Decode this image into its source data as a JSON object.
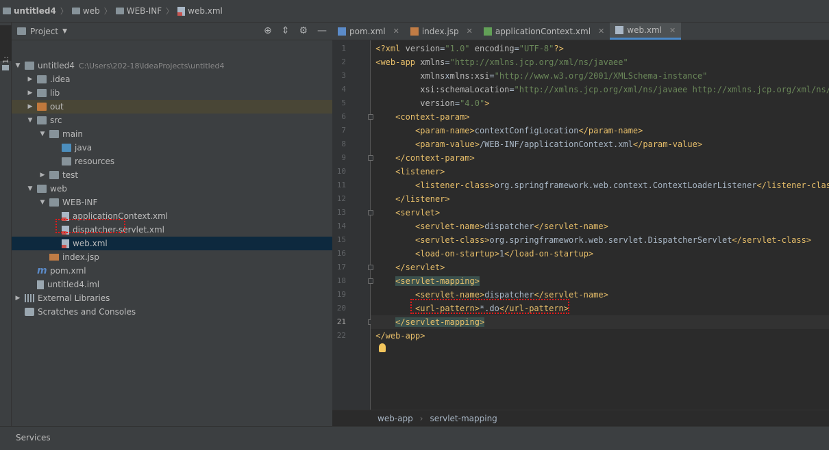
{
  "navbar": {
    "crumbs": [
      "untitled4",
      "web",
      "WEB-INF",
      "web.xml"
    ]
  },
  "left_strip": {
    "project_tab": "1: Project"
  },
  "project_panel": {
    "title": "Project",
    "tree": [
      {
        "label": "untitled4",
        "path": "C:\\Users\\202-18\\IdeaProjects\\untitled4",
        "depth": 0,
        "arrow": "▼",
        "icon": "folder"
      },
      {
        "label": ".idea",
        "depth": 1,
        "arrow": "▶",
        "icon": "folder"
      },
      {
        "label": "lib",
        "depth": 1,
        "arrow": "▶",
        "icon": "folder"
      },
      {
        "label": "out",
        "depth": 1,
        "arrow": "▶",
        "icon": "folder-orange"
      },
      {
        "label": "src",
        "depth": 1,
        "arrow": "▼",
        "icon": "folder"
      },
      {
        "label": "main",
        "depth": 2,
        "arrow": "▼",
        "icon": "folder"
      },
      {
        "label": "java",
        "depth": 3,
        "arrow": "",
        "icon": "folder-blue"
      },
      {
        "label": "resources",
        "depth": 3,
        "arrow": "",
        "icon": "folder"
      },
      {
        "label": "test",
        "depth": 2,
        "arrow": "▶",
        "icon": "folder"
      },
      {
        "label": "web",
        "depth": 1,
        "arrow": "▼",
        "icon": "folder"
      },
      {
        "label": "WEB-INF",
        "depth": 2,
        "arrow": "▼",
        "icon": "folder"
      },
      {
        "label": "applicationContext.xml",
        "depth": 3,
        "arrow": "",
        "icon": "xml"
      },
      {
        "label": "dispatcher-servlet.xml",
        "depth": 3,
        "arrow": "",
        "icon": "xml"
      },
      {
        "label": "web.xml",
        "depth": 3,
        "arrow": "",
        "icon": "xml"
      },
      {
        "label": "index.jsp",
        "depth": 2,
        "arrow": "",
        "icon": "jsp"
      },
      {
        "label": "pom.xml",
        "depth": 1,
        "arrow": "",
        "icon": "maven"
      },
      {
        "label": "untitled4.iml",
        "depth": 1,
        "arrow": "",
        "icon": "iml"
      },
      {
        "label": "External Libraries",
        "depth": 0,
        "arrow": "▶",
        "icon": "libraries"
      },
      {
        "label": "Scratches and Consoles",
        "depth": 0,
        "arrow": "",
        "icon": "scratch"
      }
    ],
    "selected_item": "web.xml"
  },
  "editor": {
    "tabs": [
      {
        "label": "pom.xml",
        "icon": "maven-icon",
        "active": false
      },
      {
        "label": "index.jsp",
        "icon": "jsp-icon",
        "active": false
      },
      {
        "label": "applicationContext.xml",
        "icon": "spring-xml-icon",
        "active": false
      },
      {
        "label": "web.xml",
        "icon": "web-xml-icon",
        "active": true
      }
    ],
    "current_line": 21,
    "lines": [
      [
        [
          "pi",
          "<?xml "
        ],
        [
          "attr",
          "version"
        ],
        [
          "",
          "="
        ],
        [
          "val",
          "\"1.0\""
        ],
        [
          "attr",
          " encoding"
        ],
        [
          "",
          "="
        ],
        [
          "val",
          "\"UTF-8\""
        ],
        [
          "pi",
          "?>"
        ]
      ],
      [
        [
          "tag",
          "<web-app "
        ],
        [
          "attr",
          "xmlns"
        ],
        [
          "",
          "="
        ],
        [
          "val",
          "\"http://xmlns.jcp.org/xml/ns/javaee\""
        ]
      ],
      [
        [
          "",
          "         "
        ],
        [
          "attr",
          "xmlns"
        ],
        [
          "",
          "x"
        ],
        [
          "attr",
          "mlns:xsi"
        ],
        [
          "",
          "="
        ],
        [
          "val",
          "\"http://www.w3.org/2001/XMLSchema-instance\""
        ]
      ],
      [
        [
          "",
          "         "
        ],
        [
          "attr",
          "xsi:schemaLocation"
        ],
        [
          "",
          "="
        ],
        [
          "val",
          "\"http://xmlns.jcp.org/xml/ns/javaee http://xmlns.jcp.org/xml/ns/jav"
        ]
      ],
      [
        [
          "",
          "         "
        ],
        [
          "attr",
          "version"
        ],
        [
          "",
          "="
        ],
        [
          "val",
          "\"4.0\""
        ],
        [
          "tag",
          ">"
        ]
      ],
      [
        [
          "",
          "    "
        ],
        [
          "tag",
          "<context-param>"
        ]
      ],
      [
        [
          "",
          "        "
        ],
        [
          "tag",
          "<param-name>"
        ],
        [
          "",
          "contextConfigLocation"
        ],
        [
          "tag",
          "</param-name>"
        ]
      ],
      [
        [
          "",
          "        "
        ],
        [
          "tag",
          "<param-value>"
        ],
        [
          "",
          "/WEB-INF/applicationContext.xml"
        ],
        [
          "tag",
          "</param-value>"
        ]
      ],
      [
        [
          "",
          "    "
        ],
        [
          "tag",
          "</context-param>"
        ]
      ],
      [
        [
          "",
          "    "
        ],
        [
          "tag",
          "<listener>"
        ]
      ],
      [
        [
          "",
          "        "
        ],
        [
          "tag",
          "<listener-class>"
        ],
        [
          "",
          "org.springframework.web.context.ContextLoaderListener"
        ],
        [
          "tag",
          "</listener-class>"
        ]
      ],
      [
        [
          "",
          "    "
        ],
        [
          "tag",
          "</listener>"
        ]
      ],
      [
        [
          "",
          "    "
        ],
        [
          "tag",
          "<servlet>"
        ]
      ],
      [
        [
          "",
          "        "
        ],
        [
          "tag",
          "<servlet-name>"
        ],
        [
          "",
          "dispatcher"
        ],
        [
          "tag",
          "</servlet-name>"
        ]
      ],
      [
        [
          "",
          "        "
        ],
        [
          "tag",
          "<servlet-class>"
        ],
        [
          "",
          "org.springframework.web.servlet.DispatcherServlet"
        ],
        [
          "tag",
          "</servlet-class>"
        ]
      ],
      [
        [
          "",
          "        "
        ],
        [
          "tag",
          "<load-on-startup>"
        ],
        [
          "",
          "1"
        ],
        [
          "tag",
          "</load-on-startup>"
        ]
      ],
      [
        [
          "",
          "    "
        ],
        [
          "tag",
          "</servlet>"
        ]
      ],
      [
        [
          "",
          "    "
        ],
        [
          "tagbg",
          "<servlet-mapping>"
        ]
      ],
      [
        [
          "",
          "        "
        ],
        [
          "tag",
          "<servlet-name>"
        ],
        [
          "",
          "dispatcher"
        ],
        [
          "tag",
          "</servlet-name>"
        ]
      ],
      [
        [
          "",
          "        "
        ],
        [
          "tag",
          "<url-pattern>"
        ],
        [
          "",
          "*.do"
        ],
        [
          "tag",
          "</url-pattern>"
        ]
      ],
      [
        [
          "",
          "    "
        ],
        [
          "tagbg",
          "</servlet-mapping>"
        ]
      ],
      [
        [
          "tag",
          "</web-app>"
        ]
      ]
    ],
    "breadcrumb": [
      "web-app",
      "servlet-mapping"
    ]
  },
  "bottom": {
    "services_label": "Services"
  }
}
